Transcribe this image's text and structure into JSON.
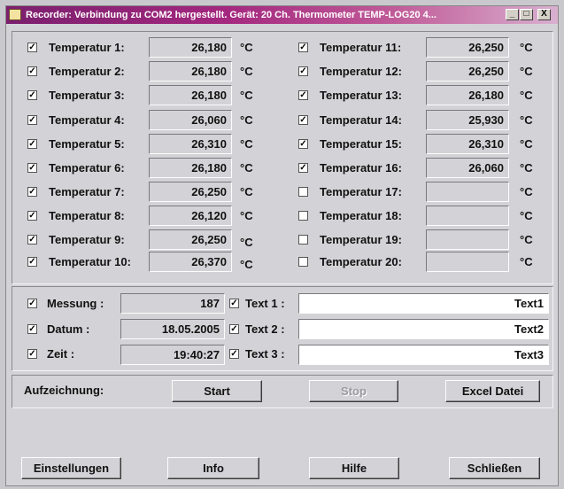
{
  "window": {
    "title": "Recorder: Verbindung zu COM2 hergestellt. Gerät: 20 Ch. Thermometer TEMP-LOG20 4...",
    "minimize": "_",
    "maximize": "□",
    "close": "X"
  },
  "check_mark": "✓",
  "unit": "°C",
  "channels": [
    {
      "label": "Temperatur 1:",
      "checked": true,
      "value": "26,180"
    },
    {
      "label": "Temperatur 2:",
      "checked": true,
      "value": "26,180"
    },
    {
      "label": "Temperatur 3:",
      "checked": true,
      "value": "26,180"
    },
    {
      "label": "Temperatur 4:",
      "checked": true,
      "value": "26,060"
    },
    {
      "label": "Temperatur 5:",
      "checked": true,
      "value": "26,310"
    },
    {
      "label": "Temperatur 6:",
      "checked": true,
      "value": "26,180"
    },
    {
      "label": "Temperatur 7:",
      "checked": true,
      "value": "26,250"
    },
    {
      "label": "Temperatur 8:",
      "checked": true,
      "value": "26,120"
    },
    {
      "label": "Temperatur 9:",
      "checked": true,
      "value": "26,250"
    },
    {
      "label": "Temperatur 10:",
      "checked": true,
      "value": "26,370"
    },
    {
      "label": "Temperatur 11:",
      "checked": true,
      "value": "26,250"
    },
    {
      "label": "Temperatur 12:",
      "checked": true,
      "value": "26,250"
    },
    {
      "label": "Temperatur 13:",
      "checked": true,
      "value": "26,180"
    },
    {
      "label": "Temperatur 14:",
      "checked": true,
      "value": "25,930"
    },
    {
      "label": "Temperatur 15:",
      "checked": true,
      "value": "26,310"
    },
    {
      "label": "Temperatur 16:",
      "checked": true,
      "value": "26,060"
    },
    {
      "label": "Temperatur 17:",
      "checked": false,
      "value": ""
    },
    {
      "label": "Temperatur 18:",
      "checked": false,
      "value": ""
    },
    {
      "label": "Temperatur 19:",
      "checked": false,
      "value": ""
    },
    {
      "label": "Temperatur 20:",
      "checked": false,
      "value": ""
    }
  ],
  "info": {
    "messung": {
      "label": "Messung :",
      "checked": true,
      "value": "187"
    },
    "datum": {
      "label": "Datum :",
      "checked": true,
      "value": "18.05.2005"
    },
    "zeit": {
      "label": "Zeit :",
      "checked": true,
      "value": "19:40:27"
    },
    "texts": [
      {
        "label": "Text 1 :",
        "checked": true,
        "value": "Text1"
      },
      {
        "label": "Text 2 :",
        "checked": true,
        "value": "Text2"
      },
      {
        "label": "Text 3 :",
        "checked": true,
        "value": "Text3"
      }
    ]
  },
  "recording": {
    "label": "Aufzeichnung:",
    "start": "Start",
    "stop": "Stop",
    "excel": "Excel Datei"
  },
  "footer": {
    "settings": "Einstellungen",
    "info": "Info",
    "help": "Hilfe",
    "close": "Schließen"
  }
}
